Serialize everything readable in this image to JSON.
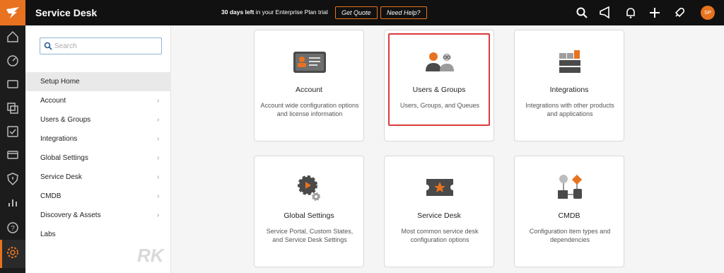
{
  "app": {
    "title": "Service Desk"
  },
  "trial": {
    "bold": "30 days left",
    "rest": " in your Enterprise Plan trial"
  },
  "header": {
    "get_quote": "Get Quote",
    "need_help": "Need Help?",
    "avatar_initials": "SP",
    "icons": [
      "search-icon",
      "announcement-icon",
      "bell-icon",
      "plus-icon",
      "rocket-icon"
    ]
  },
  "rail": {
    "icons": [
      "home-icon",
      "dashboard-icon",
      "ticket-icon",
      "assets-icon",
      "tasks-icon",
      "card-icon",
      "shield-icon",
      "reports-icon",
      "help-icon",
      "settings-icon"
    ]
  },
  "sidebar": {
    "search_placeholder": "Search",
    "items": [
      {
        "label": "Setup Home",
        "chevron": false
      },
      {
        "label": "Account",
        "chevron": true
      },
      {
        "label": "Users & Groups",
        "chevron": true
      },
      {
        "label": "Integrations",
        "chevron": true
      },
      {
        "label": "Global Settings",
        "chevron": true
      },
      {
        "label": "Service Desk",
        "chevron": true
      },
      {
        "label": "CMDB",
        "chevron": true
      },
      {
        "label": "Discovery & Assets",
        "chevron": true
      },
      {
        "label": "Labs",
        "chevron": false
      }
    ]
  },
  "cards": [
    {
      "title": "Account",
      "desc": "Account wide configuration options and license information",
      "icon": "id-card-icon"
    },
    {
      "title": "Users & Groups",
      "desc": "Users, Groups, and Queues",
      "icon": "users-icon",
      "highlighted": true
    },
    {
      "title": "Integrations",
      "desc": "Integrations with other products and applications",
      "icon": "integrations-icon"
    },
    {
      "title": "Global Settings",
      "desc": "Service Portal, Custom States, and Service Desk Settings",
      "icon": "gears-icon"
    },
    {
      "title": "Service Desk",
      "desc": "Most common service desk configuration options",
      "icon": "ticket-star-icon"
    },
    {
      "title": "CMDB",
      "desc": "Configuration item types and dependencies",
      "icon": "flowchart-icon"
    }
  ],
  "watermark": "RK",
  "colors": {
    "accent": "#e8721f",
    "topbar": "#111111",
    "rail": "#1c1c1c",
    "highlight": "#d93c3c"
  }
}
